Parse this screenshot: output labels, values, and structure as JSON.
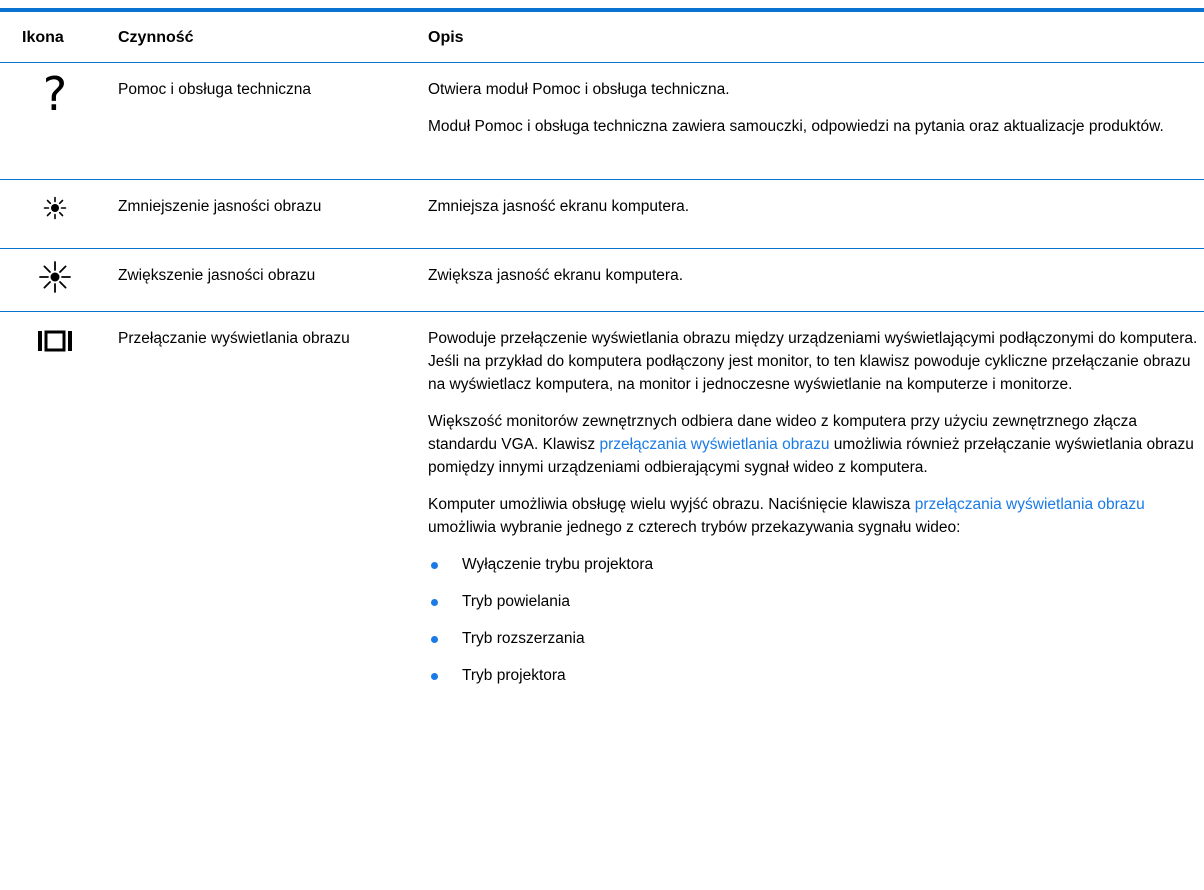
{
  "header": {
    "icon": "Ikona",
    "action": "Czynność",
    "description": "Opis"
  },
  "rows": [
    {
      "icon": "question-mark-icon",
      "icon_glyph": "?",
      "action": "Pomoc i obsługa techniczna",
      "paragraphs": [
        "Otwiera moduł Pomoc i obsługa techniczna.",
        "Moduł Pomoc i obsługa techniczna zawiera samouczki, odpowiedzi na pytania oraz aktualizacje produktów."
      ]
    },
    {
      "icon": "brightness-down-icon",
      "action": "Zmniejszenie jasności obrazu",
      "paragraphs": [
        "Zmniejsza jasność ekranu komputera."
      ]
    },
    {
      "icon": "brightness-up-icon",
      "action": "Zwiększenie jasności obrazu",
      "paragraphs": [
        "Zwiększa jasność ekranu komputera."
      ]
    },
    {
      "icon": "display-switch-icon",
      "action": "Przełączanie wyświetlania obrazu",
      "paragraphs": [
        "Powoduje przełączenie wyświetlania obrazu między urządzeniami wyświetlającymi podłączonymi do komputera. Jeśli na przykład do komputera podłączony jest monitor, to ten klawisz powoduje cykliczne przełączanie obrazu na wyświetlacz komputera, na monitor i jednoczesne wyświetlanie na komputerze i monitorze."
      ],
      "p2_before": "Większość monitorów zewnętrznych odbiera dane wideo z komputera przy użyciu zewnętrznego złącza standardu VGA. Klawisz ",
      "p2_link": "przełączania wyświetlania obrazu",
      "p2_after": " umożliwia również przełączanie wyświetlania obrazu pomiędzy innymi urządzeniami odbierającymi sygnał wideo z komputera.",
      "p3_before": "Komputer umożliwia obsługę wielu wyjść obrazu. Naciśnięcie klawisza ",
      "p3_link": "przełączania wyświetlania obrazu",
      "p3_after": " umożliwia wybranie jednego z czterech trybów przekazywania sygnału wideo:",
      "bullets": [
        "Wyłączenie trybu projektora",
        "Tryb powielania",
        "Tryb rozszerzania",
        "Tryb projektora"
      ]
    }
  ],
  "colors": {
    "rule": "#0a73d1",
    "link": "#1a7be6",
    "bullet": "#1a7be6"
  }
}
